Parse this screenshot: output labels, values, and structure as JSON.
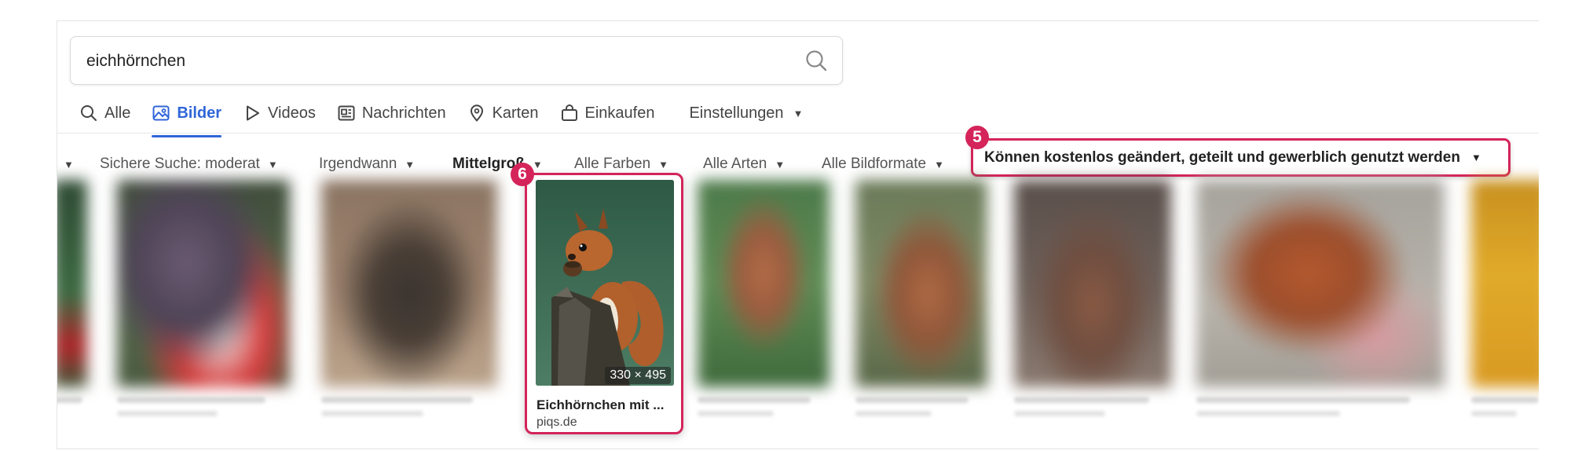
{
  "search": {
    "query": "eichhörnchen"
  },
  "tabs": [
    {
      "label": "Alle",
      "icon": "search-icon"
    },
    {
      "label": "Bilder",
      "icon": "image-icon",
      "active": true
    },
    {
      "label": "Videos",
      "icon": "play-icon"
    },
    {
      "label": "Nachrichten",
      "icon": "newspaper-icon"
    },
    {
      "label": "Karten",
      "icon": "map-pin-icon"
    },
    {
      "label": "Einkaufen",
      "icon": "shopping-bag-icon"
    }
  ],
  "settings_label": "Einstellungen",
  "filters": {
    "region_caret": "▾",
    "safe_search": "Sichere Suche: moderat",
    "time": "Irgendwann",
    "size": "Mittelgroß",
    "color": "Alle Farben",
    "type": "Alle Arten",
    "layout": "Alle Bildformate",
    "license": "Können kostenlos geändert, geteilt und gewerblich genutzt werden"
  },
  "annotations": {
    "filter_badge": "5",
    "card_badge": "6"
  },
  "featured_result": {
    "dimensions": "330 × 495",
    "title": "Eichhörnchen mit ...",
    "source": "piqs.de"
  },
  "colors": {
    "accent": "#2f66d8",
    "highlight": "#d4245a"
  }
}
